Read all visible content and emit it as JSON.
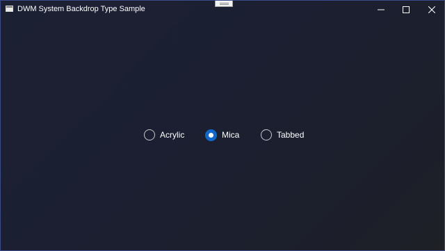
{
  "window": {
    "title": "DWM System Backdrop Type Sample"
  },
  "caption_buttons": {
    "minimize": "minimize-icon",
    "maximize": "maximize-icon",
    "close": "close-icon"
  },
  "backdrop_options": [
    {
      "label": "Acrylic",
      "checked": false
    },
    {
      "label": "Mica",
      "checked": true
    },
    {
      "label": "Tabbed",
      "checked": false
    }
  ],
  "colors": {
    "accent": "#0f67cc",
    "background": "#1c1f31",
    "border": "#3a4a8a"
  }
}
